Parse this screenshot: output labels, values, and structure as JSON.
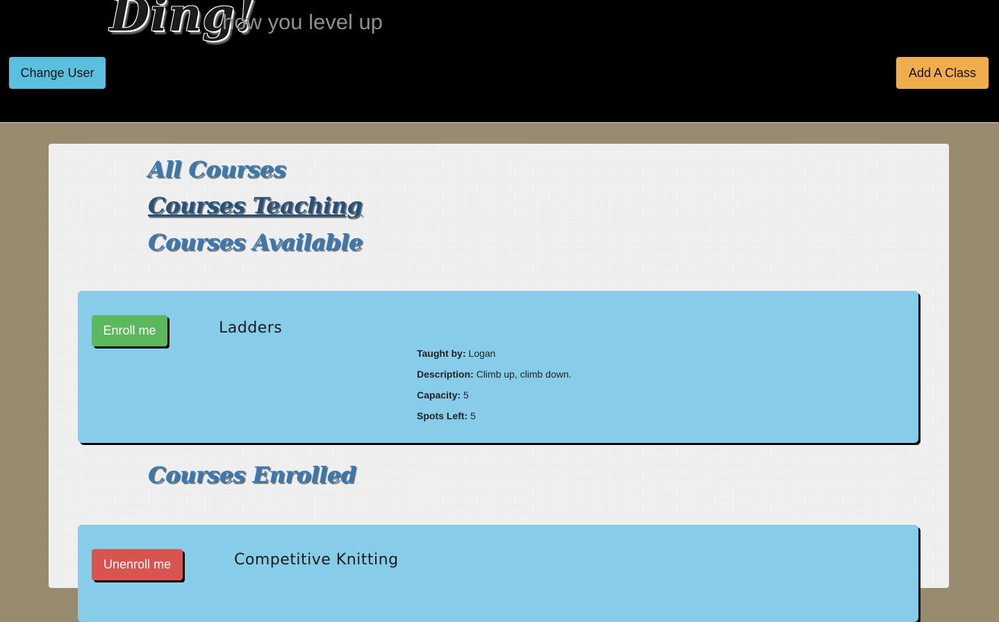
{
  "header": {
    "logo_text": "Ding!",
    "tagline": "how you level up",
    "change_user_label": "Change User",
    "add_class_label": "Add A Class"
  },
  "nav": {
    "all_courses": "All Courses",
    "courses_teaching": "Courses Teaching",
    "courses_available": "Courses Available",
    "active": "courses_teaching"
  },
  "available_courses": [
    {
      "button_label": "Enroll me",
      "name": "Ladders",
      "taught_by_label": "Taught by:",
      "taught_by": "Logan",
      "description_label": "Description:",
      "description": "Climb up, climb down.",
      "capacity_label": "Capacity:",
      "capacity": "5",
      "spots_left_label": "Spots Left:",
      "spots_left": "5"
    }
  ],
  "enrolled_section_title": "Courses Enrolled",
  "enrolled_courses": [
    {
      "button_label": "Unenroll me",
      "name": "Competitive Knitting"
    }
  ],
  "colors": {
    "page_background": "#998c6e",
    "header_background": "#000000",
    "card_background": "#87cdea",
    "link_blue": "#337ab7",
    "info_button": "#5bc0de",
    "warning_button": "#f0ad4e",
    "success_button": "#5cb85c",
    "danger_button": "#d9534f"
  }
}
